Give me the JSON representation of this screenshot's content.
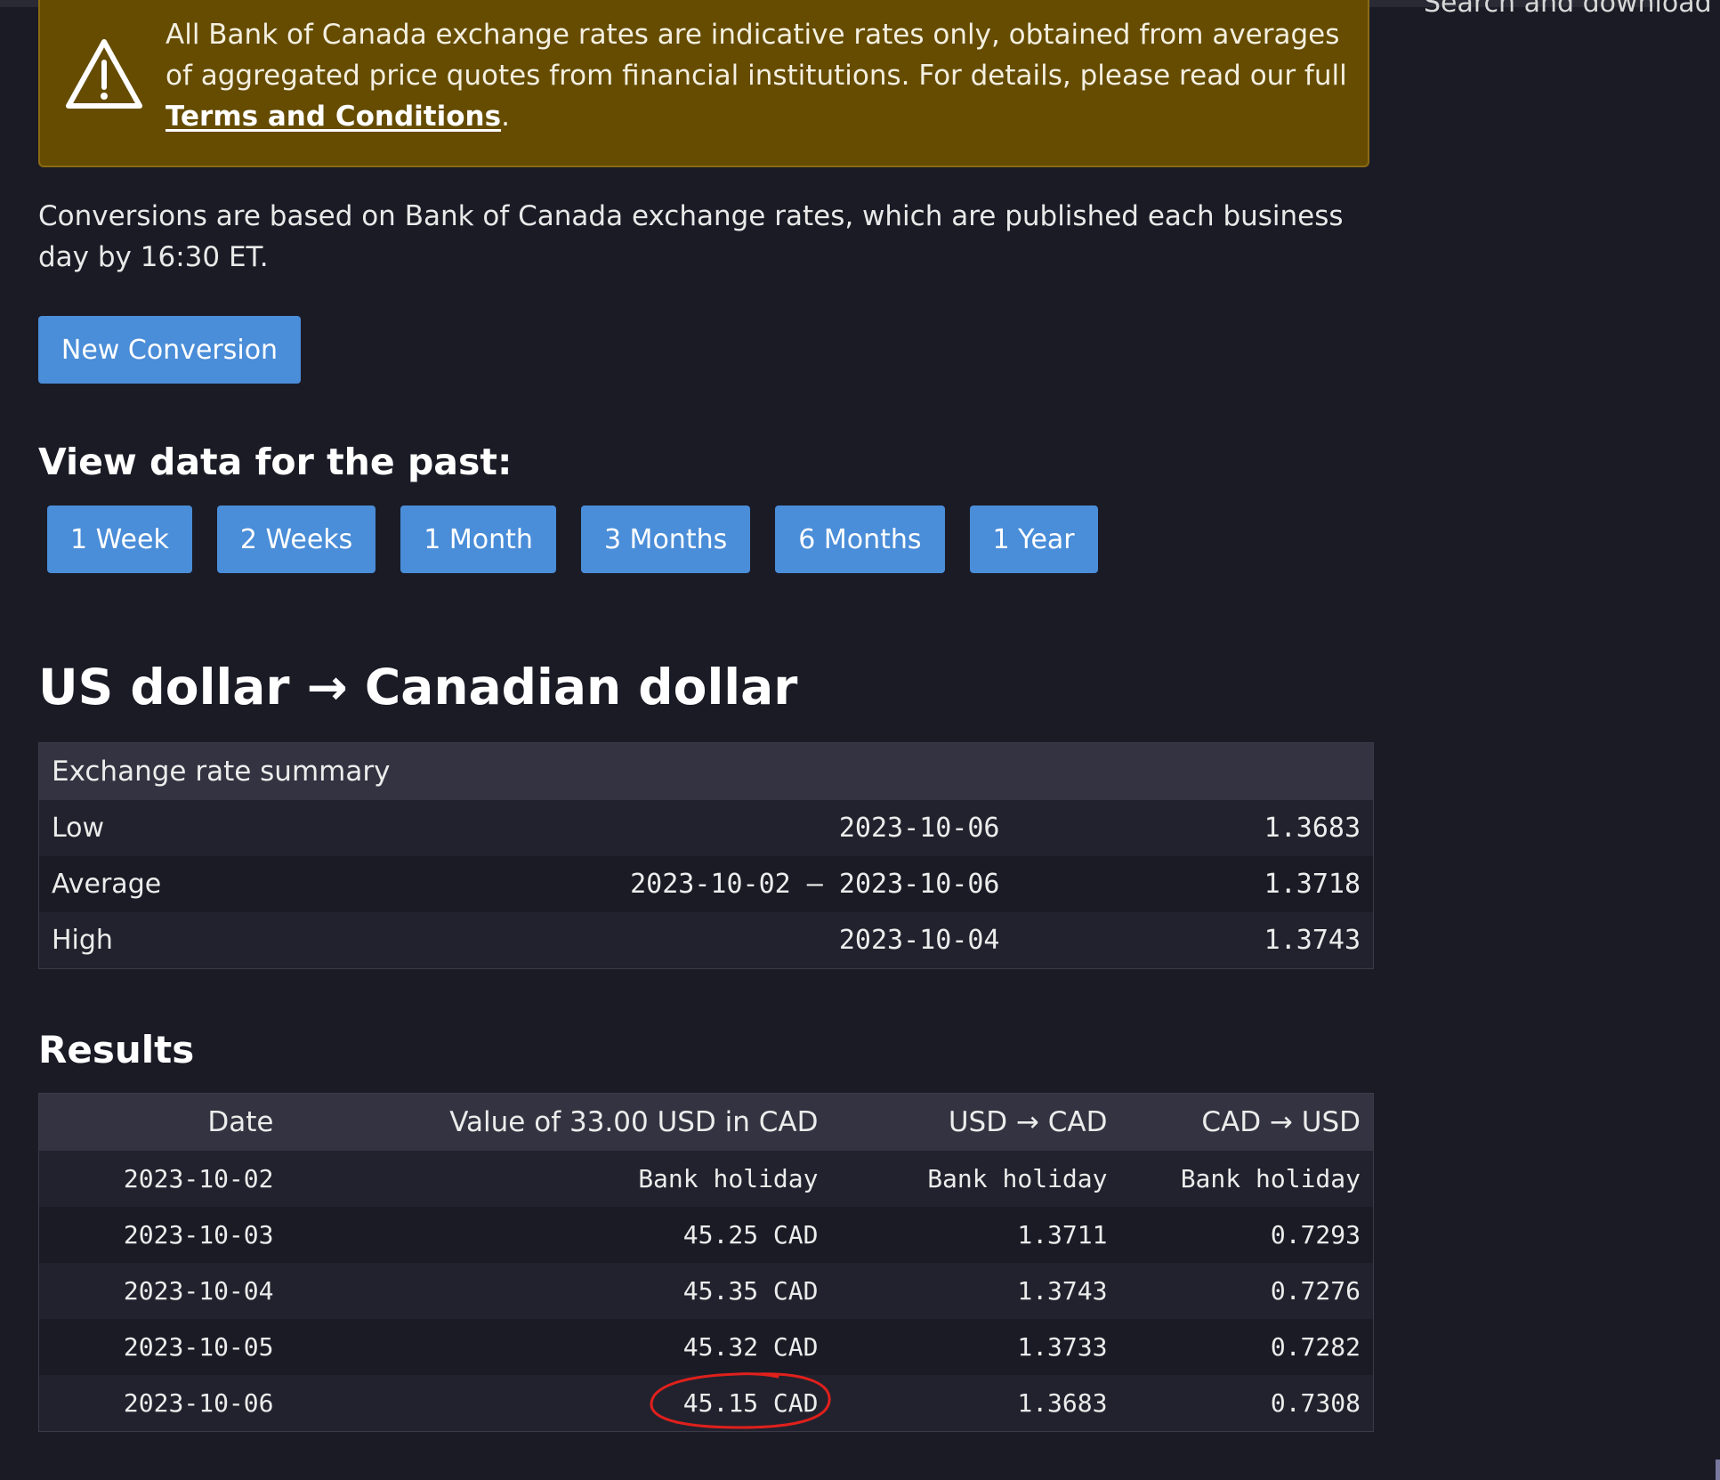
{
  "sidebar": {
    "partial_text": "Search and download"
  },
  "alert": {
    "icon": "warning-triangle-icon",
    "text_before": "All Bank of Canada exchange rates are indicative rates only, obtained from averages of aggregated price quotes from financial institutions. For details, please read our full ",
    "link_text": "Terms and Conditions",
    "text_after": "."
  },
  "intro": {
    "text": "Conversions are based on Bank of Canada exchange rates, which are published each business day by 16:30 ET."
  },
  "new_conversion_label": "New Conversion",
  "period": {
    "heading": "View data for the past:",
    "buttons": [
      "1 Week",
      "2 Weeks",
      "1 Month",
      "3 Months",
      "6 Months",
      "1 Year"
    ]
  },
  "pair_heading": "US dollar → Canadian dollar",
  "summary": {
    "header": "Exchange rate summary",
    "rows": [
      {
        "label": "Low",
        "date": "2023-10-06",
        "value": "1.3683"
      },
      {
        "label": "Average",
        "date": "2023-10-02 – 2023-10-06",
        "value": "1.3718"
      },
      {
        "label": "High",
        "date": "2023-10-04",
        "value": "1.3743"
      }
    ]
  },
  "results": {
    "heading": "Results",
    "columns": [
      "Date",
      "Value of 33.00 USD in CAD",
      "USD → CAD",
      "CAD → USD"
    ],
    "rows": [
      {
        "date": "2023-10-02",
        "value": "Bank holiday",
        "usd_cad": "Bank holiday",
        "cad_usd": "Bank holiday"
      },
      {
        "date": "2023-10-03",
        "value": "45.25 CAD",
        "usd_cad": "1.3711",
        "cad_usd": "0.7293"
      },
      {
        "date": "2023-10-04",
        "value": "45.35 CAD",
        "usd_cad": "1.3743",
        "cad_usd": "0.7276"
      },
      {
        "date": "2023-10-05",
        "value": "45.32 CAD",
        "usd_cad": "1.3733",
        "cad_usd": "0.7282"
      },
      {
        "date": "2023-10-06",
        "value": "45.15 CAD",
        "usd_cad": "1.3683",
        "cad_usd": "0.7308"
      }
    ],
    "highlight_color": "#e0201c"
  },
  "colors": {
    "background": "#1b1b26",
    "alert_background": "#654c00",
    "button": "#4a8dd8",
    "table_header": "#333341"
  }
}
